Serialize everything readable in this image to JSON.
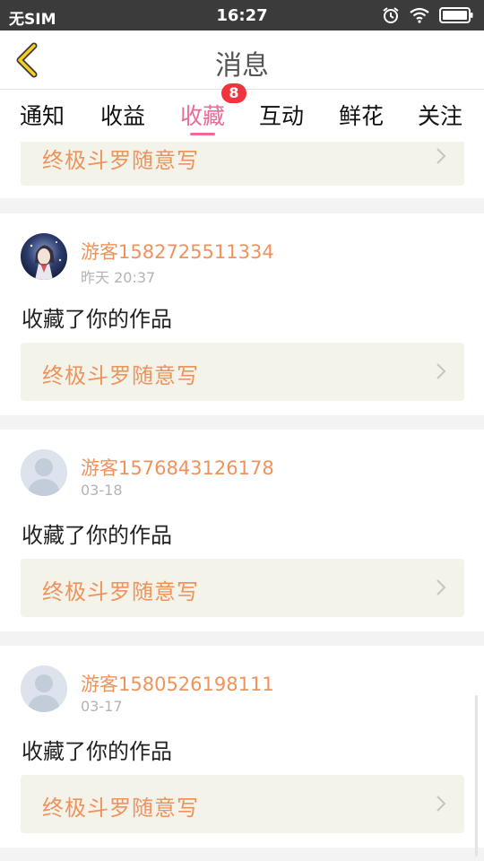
{
  "status_bar": {
    "carrier": "无SIM",
    "time": "16:27"
  },
  "header": {
    "title": "消息"
  },
  "tabs": [
    {
      "label": "通知"
    },
    {
      "label": "收益"
    },
    {
      "label": "收藏",
      "badge": "8",
      "active": true
    },
    {
      "label": "互动"
    },
    {
      "label": "鲜花"
    },
    {
      "label": "关注"
    }
  ],
  "messages": [
    {
      "work_title": "终极斗罗随意写"
    },
    {
      "username": "游客1582725511334",
      "time": "昨天 20:37",
      "action": "收藏了你的作品",
      "work_title": "终极斗罗随意写"
    },
    {
      "username": "游客1576843126178",
      "time": "03-18",
      "action": "收藏了你的作品",
      "work_title": "终极斗罗随意写"
    },
    {
      "username": "游客1580526198111",
      "time": "03-17",
      "action": "收藏了你的作品",
      "work_title": "终极斗罗随意写"
    }
  ],
  "colors": {
    "accent": "#ee6a96",
    "badge": "#f0333d",
    "username": "#f0925c",
    "statusbar": "#3b3b3b"
  }
}
